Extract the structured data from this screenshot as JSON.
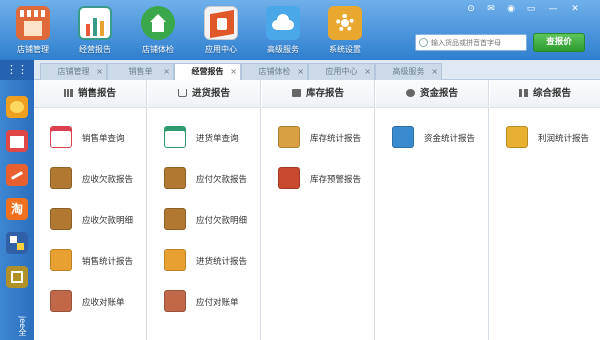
{
  "toolbar": {
    "buttons": [
      {
        "label": "店铺管理",
        "icon": "storefront-icon",
        "color": "#e06a3a"
      },
      {
        "label": "经营报告",
        "icon": "report-clipboard-icon",
        "color": "#3a9a8a"
      },
      {
        "label": "店铺体检",
        "icon": "home-check-icon",
        "color": "#3aa84a"
      },
      {
        "label": "应用中心",
        "icon": "app-center-icon",
        "color": "#e0572a"
      },
      {
        "label": "高级服务",
        "icon": "cloud-icon",
        "color": "#4aa8e8"
      },
      {
        "label": "系统设置",
        "icon": "gear-icon",
        "color": "#e8a830"
      }
    ],
    "search_placeholder": "输入货品或拼音首字母",
    "search_button": "查报价",
    "window_controls": [
      "⊙",
      "✉",
      "◉",
      "▭",
      "—",
      "✕"
    ]
  },
  "tabs": [
    {
      "label": "店铺管理",
      "active": false
    },
    {
      "label": "销售单",
      "active": false
    },
    {
      "label": "经营报告",
      "active": true
    },
    {
      "label": "店铺体检",
      "active": false
    },
    {
      "label": "应用中心",
      "active": false
    },
    {
      "label": "高级服务",
      "active": false
    }
  ],
  "tab_close": "×",
  "sidebar": {
    "grid_icon": "⋮⋮",
    "items": [
      {
        "icon": "coins-icon",
        "color": "#f0a020"
      },
      {
        "icon": "calendar-icon",
        "color": "#e04848"
      },
      {
        "icon": "chart-icon",
        "color": "#e86030"
      },
      {
        "icon": "taobao-icon",
        "color": "#f07020",
        "text": "淘"
      },
      {
        "icon": "puzzle-icon",
        "color": "#3060a8"
      },
      {
        "icon": "ledger-icon",
        "color": "#b09028"
      }
    ],
    "vertical_text": "jee全"
  },
  "columns": [
    {
      "title": "销售报告",
      "icon": "bar-chart-icon",
      "items": [
        {
          "label": "销售单查询",
          "icon": "sales-query-icon",
          "color": "#d94050"
        },
        {
          "label": "应收欠款报告",
          "icon": "receivable-report-icon",
          "color": "#b07830"
        },
        {
          "label": "应收欠款明细",
          "icon": "receivable-detail-icon",
          "color": "#b07830"
        },
        {
          "label": "销售统计报告",
          "icon": "sales-stats-icon",
          "color": "#e8a030"
        },
        {
          "label": "应收对账单",
          "icon": "receivable-statement-icon",
          "color": "#c06848"
        }
      ]
    },
    {
      "title": "进货报告",
      "icon": "cart-icon",
      "items": [
        {
          "label": "进货单查询",
          "icon": "purchase-query-icon",
          "color": "#2e9a6e"
        },
        {
          "label": "应付欠款报告",
          "icon": "payable-report-icon",
          "color": "#b07830"
        },
        {
          "label": "应付欠款明细",
          "icon": "payable-detail-icon",
          "color": "#b07830"
        },
        {
          "label": "进货统计报告",
          "icon": "purchase-stats-icon",
          "color": "#e8a030"
        },
        {
          "label": "应付对账单",
          "icon": "payable-statement-icon",
          "color": "#c06848"
        }
      ]
    },
    {
      "title": "库存报告",
      "icon": "inventory-icon",
      "items": [
        {
          "label": "库存统计报告",
          "icon": "stock-stats-icon",
          "color": "#d8a040"
        },
        {
          "label": "库存预警报告",
          "icon": "stock-warning-icon",
          "color": "#c84830"
        }
      ]
    },
    {
      "title": "资金报告",
      "icon": "funds-icon",
      "items": [
        {
          "label": "资金统计报告",
          "icon": "funds-stats-icon",
          "color": "#3a8ad0"
        }
      ]
    },
    {
      "title": "综合报告",
      "icon": "grid-icon",
      "items": [
        {
          "label": "利润统计报告",
          "icon": "profit-stats-icon",
          "color": "#e8b030"
        }
      ]
    }
  ]
}
